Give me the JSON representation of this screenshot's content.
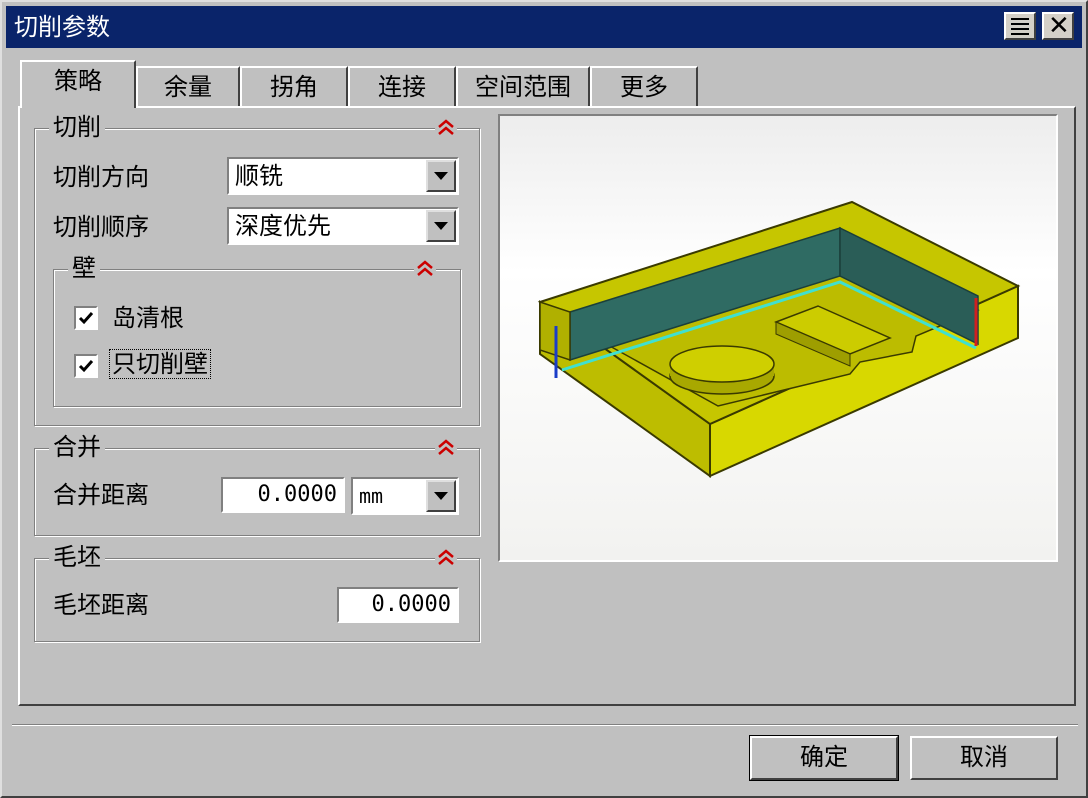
{
  "window": {
    "title": "切削参数"
  },
  "tabs": [
    {
      "label": "策略",
      "active": true
    },
    {
      "label": "余量",
      "active": false
    },
    {
      "label": "拐角",
      "active": false
    },
    {
      "label": "连接",
      "active": false
    },
    {
      "label": "空间范围",
      "active": false
    },
    {
      "label": "更多",
      "active": false
    }
  ],
  "cut_group": {
    "title": "切削",
    "direction_label": "切削方向",
    "direction_value": "顺铣",
    "order_label": "切削顺序",
    "order_value": "深度优先",
    "wall_group": {
      "title": "壁",
      "island_cleanup": {
        "label": "岛清根",
        "checked": true
      },
      "cut_walls_only": {
        "label": "只切削壁",
        "checked": true
      }
    }
  },
  "merge_group": {
    "title": "合并",
    "distance_label": "合并距离",
    "distance_value": "0.0000",
    "unit_value": "mm"
  },
  "blank_group": {
    "title": "毛坯",
    "distance_label": "毛坯距离",
    "distance_value": "0.0000"
  },
  "buttons": {
    "ok": "确定",
    "cancel": "取消"
  },
  "colors": {
    "titlebar": "#0a246a",
    "collapse_icon": "#cc0000",
    "part_yellow": "#d4d400",
    "wall_teal": "#2f6b63",
    "toolpath": "#40e0d0"
  },
  "icons": {
    "collapse": "double-chevron-up-icon",
    "menu": "menu-icon",
    "close": "close-icon",
    "check": "checkmark-icon"
  }
}
